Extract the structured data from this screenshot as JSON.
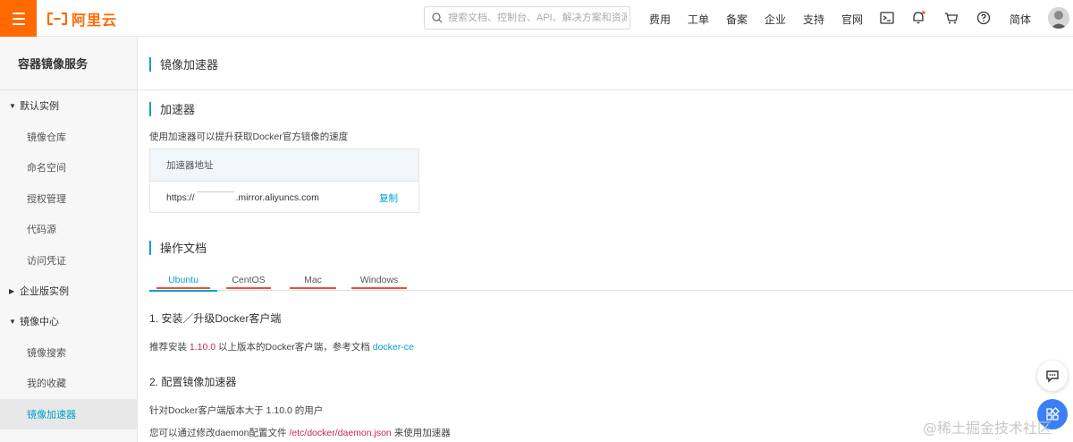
{
  "header": {
    "logo_text": "阿里云",
    "search_placeholder": "搜索文档、控制台、API、解决方案和资源",
    "nav": [
      "费用",
      "工单",
      "备案",
      "企业",
      "支持",
      "官网"
    ],
    "lang": "简体",
    "brand_color": "#ff6a00"
  },
  "sidebar": {
    "title": "容器镜像服务",
    "groups": [
      {
        "label": "默认实例",
        "expanded": true
      },
      {
        "label": "企业版实例",
        "expanded": false
      },
      {
        "label": "镜像中心",
        "expanded": true
      }
    ],
    "default_items": [
      "镜像仓库",
      "命名空间",
      "授权管理",
      "代码源",
      "访问凭证"
    ],
    "center_items": [
      "镜像搜索",
      "我的收藏",
      "镜像加速器"
    ],
    "active_item": "镜像加速器"
  },
  "main": {
    "page_title": "镜像加速器",
    "accelerator": {
      "title": "加速器",
      "description": "使用加速器可以提升获取Docker官方镜像的速度",
      "table_header": "加速器地址",
      "url_prefix": "https://",
      "url_suffix": ".mirror.aliyuncs.com",
      "copy_label": "复制"
    },
    "docs": {
      "title": "操作文档",
      "tabs": [
        "Ubuntu",
        "CentOS",
        "Mac",
        "Windows"
      ],
      "active_tab": "Ubuntu",
      "step1_title": "1. 安装／升级Docker客户端",
      "step1_text_a": "推荐安装",
      "step1_version": "1.10.0",
      "step1_text_b": "以上版本的Docker客户端，参考文档",
      "step1_link": "docker-ce",
      "step2_title": "2. 配置镜像加速器",
      "step2_text1": "针对Docker客户端版本大于 1.10.0 的用户",
      "step2_text2_a": "您可以通过修改daemon配置文件",
      "step2_path": "/etc/docker/daemon.json",
      "step2_text2_b": "来使用加速器"
    }
  },
  "watermark": "@稀土掘金技术社区",
  "colors": {
    "accent": "#00a2ca",
    "annotation_red": "#e8503a",
    "float_blue": "#3a7ff5"
  }
}
